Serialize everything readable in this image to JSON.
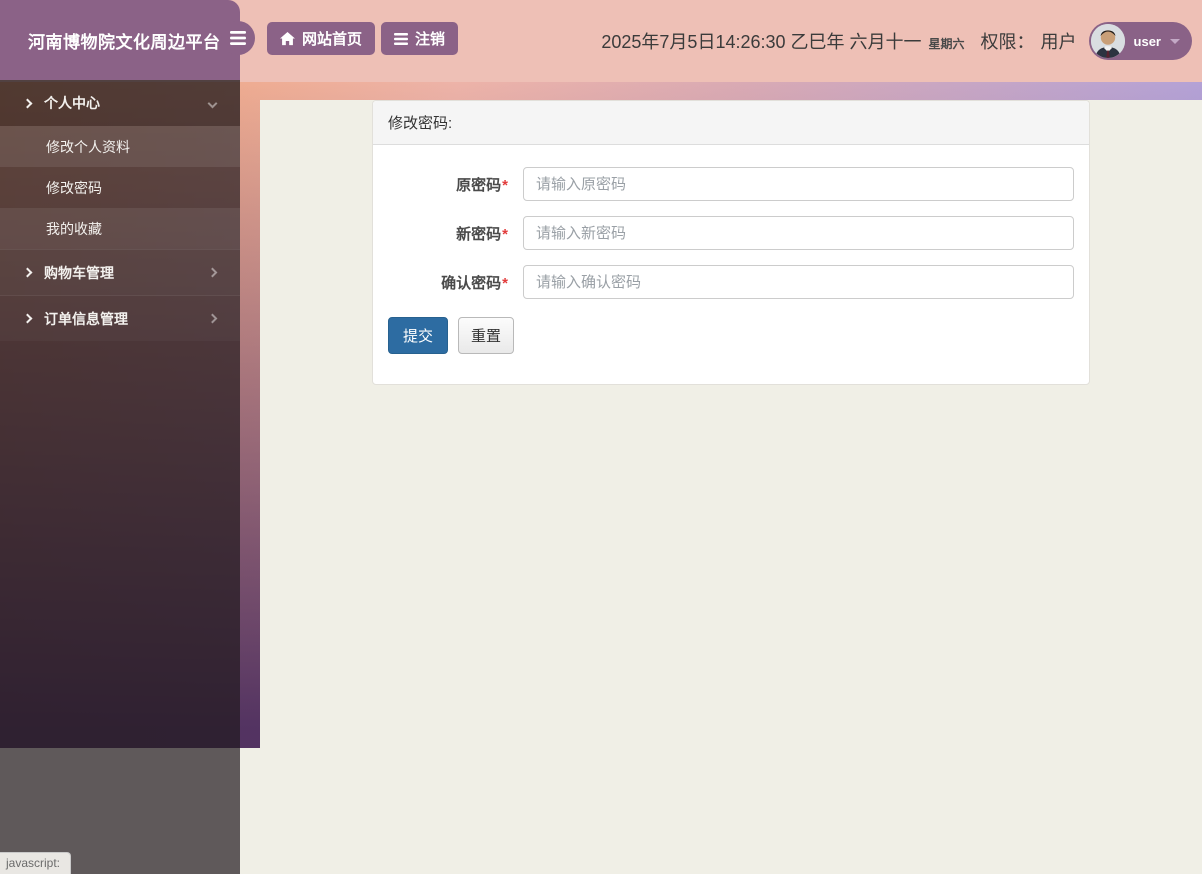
{
  "brand": {
    "title": "河南博物院文化周边平台"
  },
  "topnav": {
    "home": "网站首页",
    "logout": "注销"
  },
  "userbar": {
    "datetime": "2025年7月5日14:26:30 乙巳年 六月十一",
    "weekday": "星期六",
    "role_label": "权限：",
    "role_value": "用户",
    "username": "user"
  },
  "sidebar": {
    "items": [
      {
        "label": "个人中心",
        "type": "parent",
        "expanded": true
      },
      {
        "label": "修改个人资料",
        "type": "sub"
      },
      {
        "label": "修改密码",
        "type": "sub",
        "active": true
      },
      {
        "label": "我的收藏",
        "type": "sub"
      },
      {
        "label": "购物车管理",
        "type": "parent",
        "expanded": false
      },
      {
        "label": "订单信息管理",
        "type": "parent",
        "expanded": false
      }
    ]
  },
  "panel": {
    "title": "修改密码:",
    "required_mark": "*",
    "fields": [
      {
        "label": "原密码",
        "placeholder": "请输入原密码"
      },
      {
        "label": "新密码",
        "placeholder": "请输入新密码"
      },
      {
        "label": "确认密码",
        "placeholder": "请输入确认密码"
      }
    ],
    "submit": "提交",
    "reset": "重置"
  },
  "statusbar": {
    "text": "javascript:"
  },
  "icons": {
    "hamburger": "menu-icon (three bars)",
    "home": "home-icon (house)",
    "logout": "list-icon (three bars)",
    "parent_lead": "chevron-right-icon",
    "expanded_tail": "chevron-down-icon",
    "collapsed_tail": "chevron-right-icon",
    "user_caret": "caret-down-icon",
    "avatar": "user portrait photo"
  },
  "colors": {
    "brand_purple": "#8b6287",
    "header_pink": "#eec0b6",
    "hero_orange": "#f0a478",
    "hero_lavender": "#b4a2d6",
    "content_cream": "#f0efe6",
    "sidebar_overlay": "rgba(33,26,30,0.70)",
    "submit_blue": "#2d6ca2",
    "required_red": "#e23b3b"
  }
}
